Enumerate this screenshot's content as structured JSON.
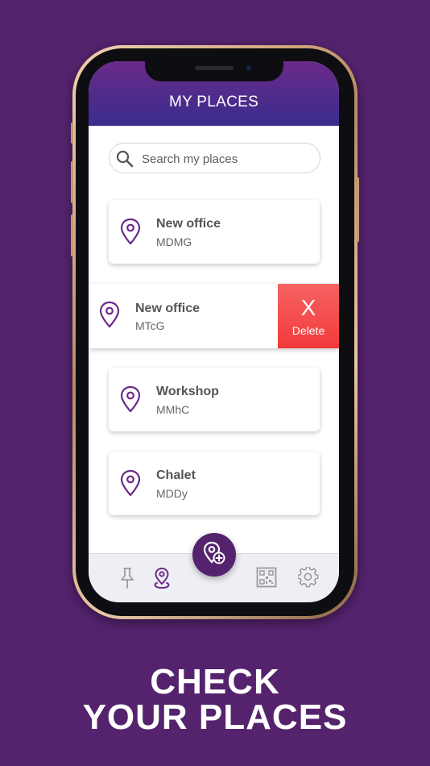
{
  "header": {
    "title": "MY PLACES"
  },
  "search": {
    "placeholder": "Search my places"
  },
  "places": [
    {
      "name": "New office",
      "code": "MDMG"
    },
    {
      "name": "New office",
      "code": "MTcG"
    },
    {
      "name": "Workshop",
      "code": "MMhC"
    },
    {
      "name": "Chalet",
      "code": "MDDy"
    }
  ],
  "swipe_action": {
    "icon_text": "X",
    "label": "Delete",
    "color": "#f24848"
  },
  "tabbar": {
    "tabs": [
      {
        "icon": "pin-icon"
      },
      {
        "icon": "location-person-icon",
        "active": true
      },
      {
        "icon": "qr-code-icon"
      },
      {
        "icon": "gear-icon"
      }
    ],
    "fab_icon": "add-location-icon"
  },
  "caption": {
    "line1": "CHECK",
    "line2": "YOUR PLACES"
  },
  "colors": {
    "background": "#55236e",
    "accent": "#6a2a8a",
    "delete": "#f24848"
  }
}
